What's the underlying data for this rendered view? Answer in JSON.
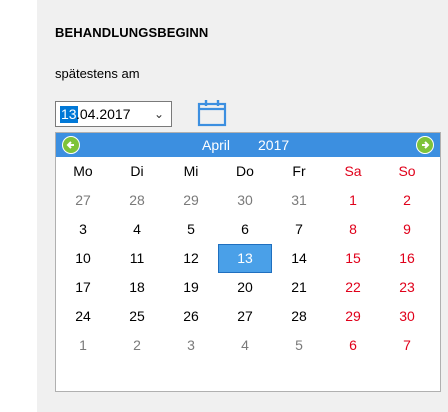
{
  "section": {
    "title": "BEHANDLUNGSBEGINN",
    "sub_label": "spätestens am"
  },
  "date_field": {
    "day": "13",
    "rest": ".04.2017",
    "chevron": "⌵"
  },
  "calendar": {
    "month": "April",
    "year": "2017",
    "prev_symbol": "◀",
    "next_symbol": "▶",
    "weekdays": [
      "Mo",
      "Di",
      "Mi",
      "Do",
      "Fr",
      "Sa",
      "So"
    ],
    "weeks": [
      [
        "27",
        "28",
        "29",
        "30",
        "31",
        "1",
        "2"
      ],
      [
        "3",
        "4",
        "5",
        "6",
        "7",
        "8",
        "9"
      ],
      [
        "10",
        "11",
        "12",
        "13",
        "14",
        "15",
        "16"
      ],
      [
        "17",
        "18",
        "19",
        "20",
        "21",
        "22",
        "23"
      ],
      [
        "24",
        "25",
        "26",
        "27",
        "28",
        "29",
        "30"
      ],
      [
        "1",
        "2",
        "3",
        "4",
        "5",
        "6",
        "7"
      ]
    ],
    "selected": "13",
    "colors": {
      "header": "#3c8fe0",
      "weekend": "#e0001a",
      "other_month": "#7a7a7a",
      "selected": "#4aa0e8"
    }
  }
}
